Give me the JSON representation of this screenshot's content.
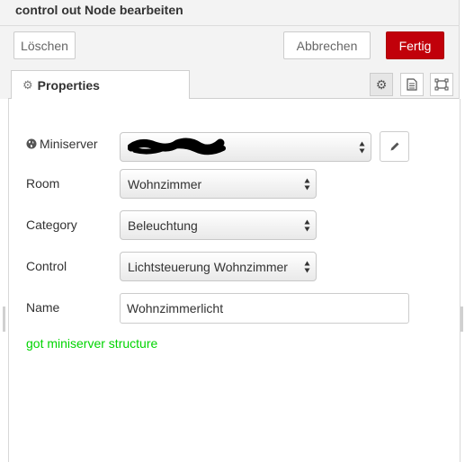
{
  "tray": {
    "title": "control out Node bearbeiten"
  },
  "toolbar": {
    "delete_label": "Löschen",
    "cancel_label": "Abbrechen",
    "done_label": "Fertig",
    "done_color": "#c1000a"
  },
  "tabs": {
    "properties_label": "Properties",
    "icons": [
      "gear-icon",
      "description-icon",
      "appearance-icon"
    ]
  },
  "form": {
    "miniserver": {
      "label": "Miniserver",
      "value": "",
      "icon": "globe-icon"
    },
    "room": {
      "label": "Room",
      "value": "Wohnzimmer"
    },
    "category": {
      "label": "Category",
      "value": "Beleuchtung"
    },
    "control": {
      "label": "Control",
      "value": "Lichtsteuerung Wohnzimmer"
    },
    "name": {
      "label": "Name",
      "value": "Wohnzimmerlicht"
    },
    "status": "got miniserver structure",
    "status_color": "#00d400"
  }
}
